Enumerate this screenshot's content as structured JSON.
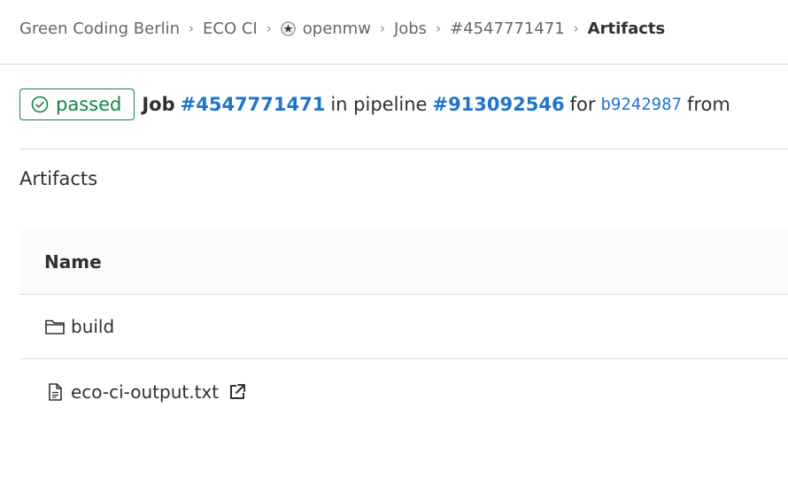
{
  "breadcrumb": {
    "items": [
      {
        "label": "Green Coding Berlin"
      },
      {
        "label": "ECO CI"
      },
      {
        "label": "openmw",
        "icon": "project-avatar-icon"
      },
      {
        "label": "Jobs"
      },
      {
        "label": "#4547771471"
      }
    ],
    "current": "Artifacts",
    "separator": "›"
  },
  "job_header": {
    "status": "passed",
    "status_color": "#108548",
    "status_icon": "check-circle-icon",
    "job_word": "Job",
    "job_id": "#4547771471",
    "in_pipeline_text": "in pipeline",
    "pipeline_id": "#913092546",
    "for_text": "for",
    "commit_sha": "b9242987",
    "from_text": "from"
  },
  "artifacts": {
    "title": "Artifacts",
    "table": {
      "header": "Name",
      "rows": [
        {
          "name": "build",
          "icon": "folder-icon"
        },
        {
          "name": "eco-ci-output.txt",
          "icon": "file-icon",
          "external_icon": "external-link-icon"
        }
      ]
    }
  },
  "colors": {
    "link": "#1f75cb",
    "text": "#303030",
    "muted": "#666666",
    "border": "#dcdcde"
  }
}
